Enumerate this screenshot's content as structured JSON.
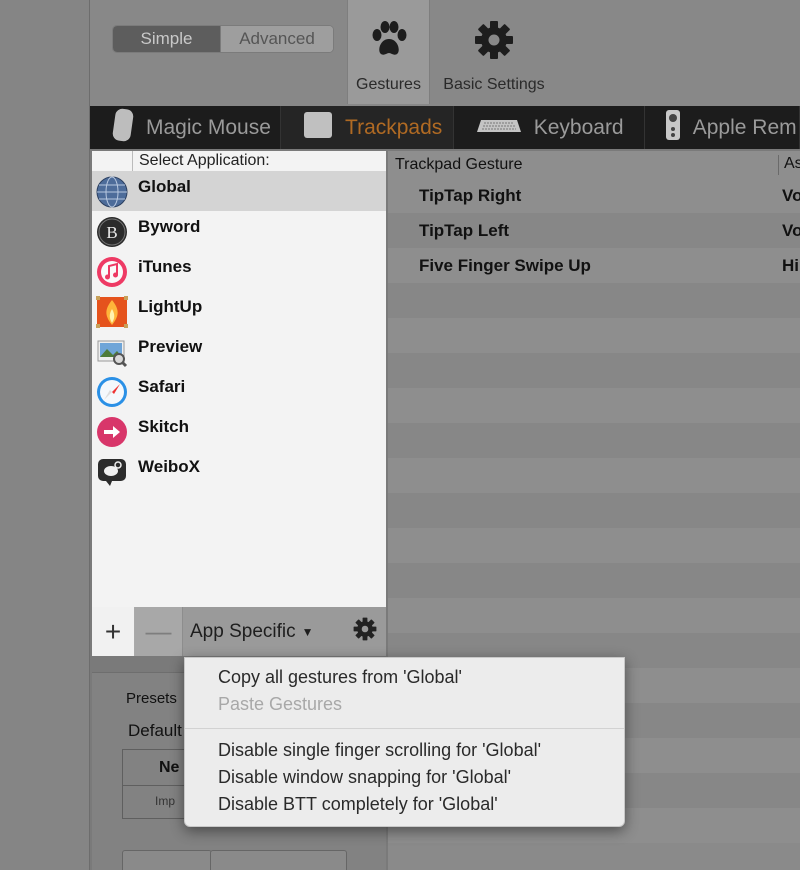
{
  "mode_segment": {
    "simple": "Simple",
    "advanced": "Advanced"
  },
  "toolbar": {
    "gestures": "Gestures",
    "basic_settings": "Basic Settings"
  },
  "devices": [
    {
      "label": "Magic Mouse",
      "icon": "magic-mouse-icon"
    },
    {
      "label": "Trackpads",
      "icon": "trackpad-icon",
      "selected": true,
      "color": "#b06a23"
    },
    {
      "label": "Keyboard",
      "icon": "keyboard-icon"
    },
    {
      "label": "Apple Rem",
      "icon": "apple-remote-icon"
    }
  ],
  "applist": {
    "header": "Select Application:",
    "apps": [
      {
        "name": "Global",
        "icon": "globe-icon",
        "selected": true
      },
      {
        "name": "Byword",
        "icon": "byword-icon"
      },
      {
        "name": "iTunes",
        "icon": "itunes-icon"
      },
      {
        "name": "LightUp",
        "icon": "lightup-icon"
      },
      {
        "name": "Preview",
        "icon": "preview-icon"
      },
      {
        "name": "Safari",
        "icon": "safari-icon"
      },
      {
        "name": "Skitch",
        "icon": "skitch-icon"
      },
      {
        "name": "WeiboX",
        "icon": "weibox-icon"
      }
    ]
  },
  "bottombar": {
    "add": "+",
    "remove": "—",
    "app_specific": "App Specific"
  },
  "lower_panel": {
    "presets": "Presets",
    "default": "Default",
    "table_head": "Ne",
    "table_cell": "Imp"
  },
  "gesture_table": {
    "col1": "Trackpad Gesture",
    "col2": "As",
    "rows": [
      {
        "gesture": "TipTap Right",
        "action": "Vo"
      },
      {
        "gesture": "TipTap Left",
        "action": "Vo"
      },
      {
        "gesture": "Five Finger Swipe Up",
        "action": "Hi"
      }
    ]
  },
  "menu": {
    "copy": "Copy all gestures from 'Global'",
    "paste": "Paste Gestures",
    "disable_scroll": "Disable single finger scrolling for 'Global'",
    "disable_snap": "Disable window snapping for 'Global'",
    "disable_btt": "Disable BTT completely for 'Global'"
  }
}
